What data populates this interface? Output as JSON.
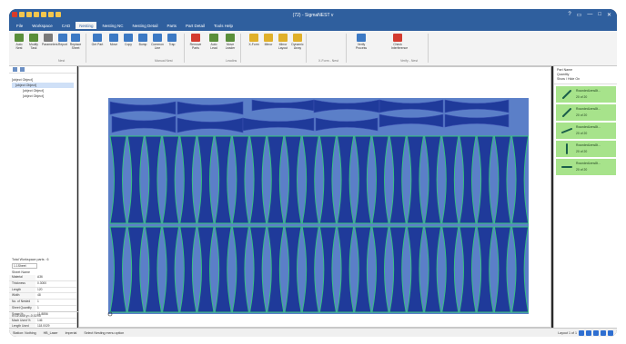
{
  "window": {
    "title": "(72) - SigmaNEST v",
    "controls": [
      "?",
      "▭",
      "—",
      "□",
      "✕"
    ]
  },
  "tabs": [
    {
      "label": "File"
    },
    {
      "label": "Workspace"
    },
    {
      "label": "CAD"
    },
    {
      "label": "Nesting",
      "active": true
    },
    {
      "label": "Nesting NC"
    },
    {
      "label": "Nesting Detail"
    },
    {
      "label": "Parts"
    },
    {
      "label": "Part Detail"
    },
    {
      "label": "Tools Help"
    }
  ],
  "ribbon": {
    "buttons": [
      {
        "label": "Auto Nest",
        "color": "#5a8f3a"
      },
      {
        "label": "Modify Task",
        "color": "#5a8f3a"
      },
      {
        "label": "Parameters",
        "color": "#7a7a7a"
      },
      {
        "label": "Report",
        "color": "#3c79c4"
      },
      {
        "label": "Replace Sheet",
        "color": "#3c79c4"
      },
      {
        "label": "Get Part",
        "color": "#3c79c4"
      },
      {
        "label": "Move",
        "color": "#3c79c4"
      },
      {
        "label": "Copy",
        "color": "#3c79c4"
      },
      {
        "label": "Bump",
        "color": "#3c79c4"
      },
      {
        "label": "Common Line",
        "color": "#3c79c4"
      },
      {
        "label": "Trap",
        "color": "#3c79c4"
      },
      {
        "label": "Remove Parts",
        "color": "#d43b2f"
      },
      {
        "label": "Auto Lead",
        "color": "#5a8f3a"
      },
      {
        "label": "Move Leader",
        "color": "#5a8f3a"
      },
      {
        "label": "X-Form",
        "color": "#e0b02a"
      },
      {
        "label": "Mirror",
        "color": "#e0b02a"
      },
      {
        "label": "Mirror Layout",
        "color": "#e0b02a"
      },
      {
        "label": "Dynamic Array",
        "color": "#e0b02a"
      },
      {
        "label": "Verify Process",
        "color": "#3c79c4"
      },
      {
        "label": "Check Interference",
        "color": "#d43b2f"
      }
    ],
    "groups": [
      {
        "label": "Nest"
      },
      {
        "label": "Manual Nest"
      },
      {
        "label": "Leadins"
      },
      {
        "label": "X-Form - Nest"
      },
      {
        "label": "Verify - Nest"
      }
    ]
  },
  "left_pane": {
    "tree": [
      {
        "label": "WORKSPACE"
      },
      {
        "label": "1"
      },
      {
        "label": "sketch1131148.0l"
      },
      {
        "label": "sketch1131148.sf"
      }
    ],
    "summary": "Total Workspace parts : 6",
    "sheet_sel": "1.1Sheet",
    "props_title": "Sheet Name",
    "properties": [
      {
        "k": "Material",
        "v": "A36"
      },
      {
        "k": "Thickness",
        "v": "0.3000"
      },
      {
        "k": "Length",
        "v": "120"
      },
      {
        "k": "Width",
        "v": "48"
      },
      {
        "k": "No. of Nested",
        "v": "1"
      },
      {
        "k": "Sheet Quantity",
        "v": "1"
      },
      {
        "k": "Scrap %",
        "v": "11.8856"
      },
      {
        "k": "Mach Used %",
        "v": "146"
      },
      {
        "k": "Length Used",
        "v": "118.0029"
      }
    ],
    "coord": "x=11.848 y=-0.0295"
  },
  "right_pane": {
    "header": [
      "Part Name",
      "Quantity",
      "Show / Hide On"
    ],
    "items": [
      {
        "name": "RoundedLens8t...",
        "qty": "20 of 20",
        "kind": "diag-up"
      },
      {
        "name": "RoundedLens8t...",
        "qty": "20 of 20",
        "kind": "diag-up"
      },
      {
        "name": "RoundedLens8t...",
        "qty": "20 of 20",
        "kind": "diag-flat"
      },
      {
        "name": "RoundedLens8t...",
        "qty": "20 of 20",
        "kind": "vertical"
      },
      {
        "name": "RoundedLens8t...",
        "qty": "20 of 20",
        "kind": "horizontal"
      }
    ]
  },
  "status": {
    "left": [
      "Station: Nothing",
      "HB_Laser",
      "Imperial",
      "Select Nesting menu option"
    ],
    "page": "Layout 1 of 1"
  },
  "colors": {
    "accent": "#2f5f9e",
    "sheet": "#5b7fc8",
    "part": "#1f3a9a",
    "part_outline": "#34c77a",
    "selected_row": "#a7e38b"
  }
}
